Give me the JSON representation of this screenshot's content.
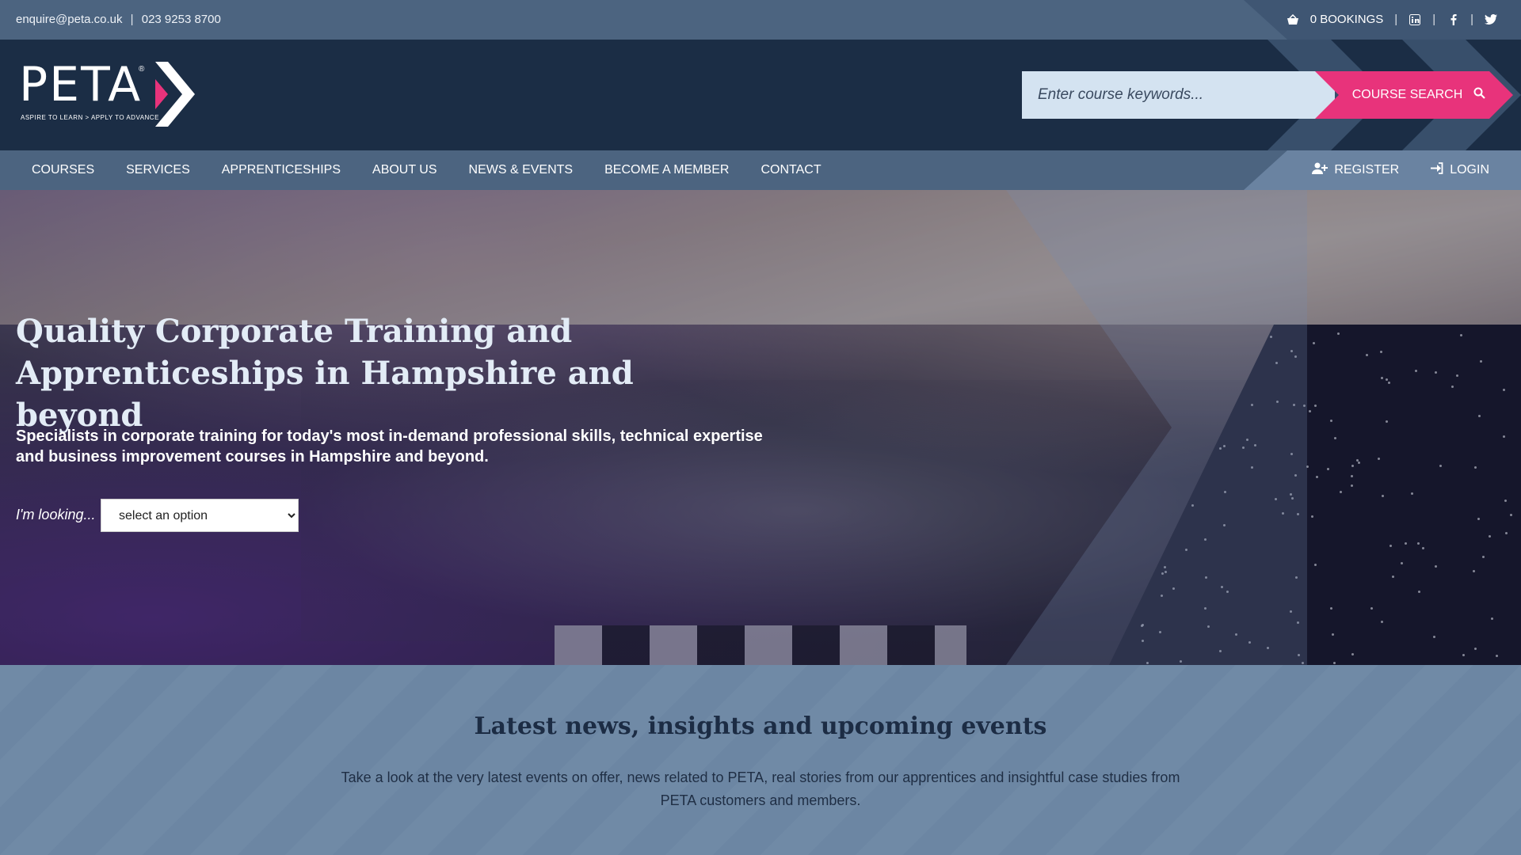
{
  "topbar": {
    "email": "enquire@peta.co.uk",
    "separator": "|",
    "phone": "023 9253 8700",
    "bookings": "0 BOOKINGS",
    "social": [
      "linkedin-icon",
      "facebook-icon",
      "twitter-icon"
    ]
  },
  "logo": {
    "text": "PETA",
    "registered": "®",
    "tagline": "ASPIRE TO LEARN > APPLY TO ADVANCE"
  },
  "search": {
    "placeholder": "Enter course keywords...",
    "button_label": "COURSE SEARCH"
  },
  "nav": {
    "items": [
      "COURSES",
      "SERVICES",
      "APPRENTICESHIPS",
      "ABOUT US",
      "NEWS & EVENTS",
      "BECOME A MEMBER",
      "CONTACT"
    ],
    "register": "REGISTER",
    "login": "LOGIN"
  },
  "hero": {
    "title_line1": "Quality Corporate Training and",
    "title_line2": "Apprenticeships in Hampshire and beyond",
    "lead": "Specialists in corporate training for today's most in-demand professional skills, technical expertise and business improvement courses in Hampshire and beyond.",
    "looking_label": "I'm looking...",
    "select_value": "select an option"
  },
  "news": {
    "heading": "Latest news, insights and upcoming events",
    "body": "Take a look at the very latest events on offer,  news related to PETA, real stories from our apprentices and insightful case studies from PETA customers and members."
  },
  "colors": {
    "navy": "#1b2d45",
    "slate": "#4c6480",
    "pink": "#e8337b",
    "light_blue": "#d4e3f1"
  }
}
